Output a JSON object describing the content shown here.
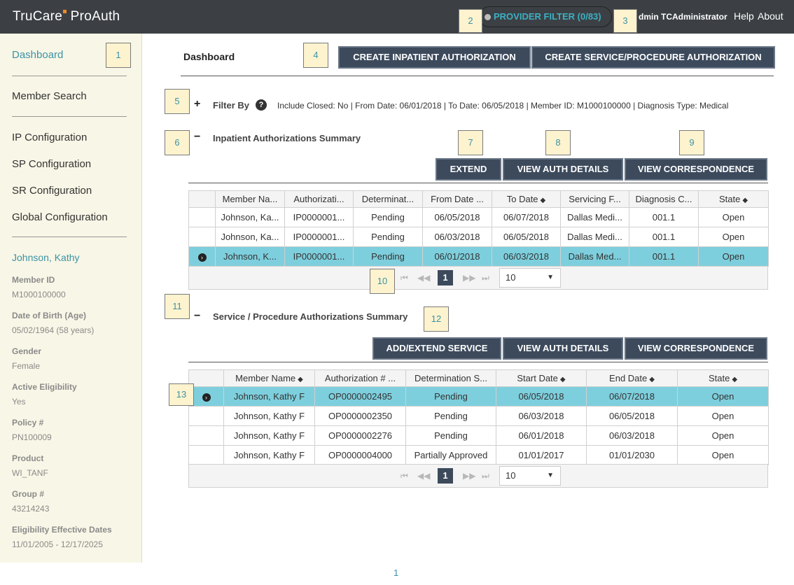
{
  "app": {
    "logo_part1": "TruCare",
    "logo_part2": "ProAuth"
  },
  "header": {
    "provider_filter": "PROVIDER FILTER (0/83)",
    "user": "dmin TCAdministrator",
    "help": "Help",
    "about": "About"
  },
  "callouts": [
    "1",
    "2",
    "3",
    "4",
    "5",
    "6",
    "7",
    "8",
    "9",
    "10",
    "11",
    "12",
    "13"
  ],
  "sidebar": {
    "nav": [
      "Dashboard",
      "Member Search",
      "IP Configuration",
      "SP Configuration",
      "SR Configuration",
      "Global Configuration"
    ],
    "member_name": "Johnson, Kathy",
    "fields": [
      {
        "label": "Member ID",
        "value": "M1000100000"
      },
      {
        "label": "Date of Birth (Age)",
        "value": "05/02/1964 (58 years)"
      },
      {
        "label": "Gender",
        "value": "Female"
      },
      {
        "label": "Active Eligibility",
        "value": "Yes"
      },
      {
        "label": "Policy #",
        "value": "PN100009"
      },
      {
        "label": "Product",
        "value": "WI_TANF"
      },
      {
        "label": "Group #",
        "value": "43214243"
      },
      {
        "label": "Eligibility Effective Dates",
        "value": "11/01/2005 - 12/17/2025"
      }
    ]
  },
  "main": {
    "title": "Dashboard",
    "create_inpatient": "CREATE INPATIENT AUTHORIZATION",
    "create_service": "CREATE SERVICE/PROCEDURE AUTHORIZATION",
    "filter": {
      "toggle": "+",
      "label": "Filter By",
      "help": "?",
      "text": "Include Closed: No | From Date: 06/01/2018 | To Date: 06/05/2018 | Member ID: M1000100000 | Diagnosis Type: Medical"
    },
    "inpatient": {
      "toggle": "−",
      "title": "Inpatient Authorizations Summary",
      "buttons": {
        "extend": "EXTEND",
        "view_details": "VIEW AUTH DETAILS",
        "view_corr": "VIEW CORRESPONDENCE"
      },
      "columns": [
        "",
        "Member Na...",
        "Authorizati...",
        "Determinat...",
        "From Date ...",
        "To Date",
        "Servicing F...",
        "Diagnosis C...",
        "State"
      ],
      "sort_icon": "◆",
      "row_icon": "›",
      "rows": [
        {
          "selected": false,
          "cells": [
            "Johnson, Ka...",
            "IP0000001...",
            "Pending",
            "06/05/2018",
            "06/07/2018",
            "Dallas Medi...",
            "001.1",
            "Open"
          ]
        },
        {
          "selected": false,
          "cells": [
            "Johnson, Ka...",
            "IP0000001...",
            "Pending",
            "06/03/2018",
            "06/05/2018",
            "Dallas Medi...",
            "001.1",
            "Open"
          ]
        },
        {
          "selected": true,
          "cells": [
            "Johnson, K...",
            "IP0000001...",
            "Pending",
            "06/01/2018",
            "06/03/2018",
            "Dallas Med...",
            "001.1",
            "Open"
          ]
        }
      ],
      "pager": {
        "page": "1",
        "size": "10",
        "first": "⏮",
        "prev": "◀◀",
        "next": "▶▶",
        "last": "⏭",
        "caret": "▼"
      }
    },
    "service": {
      "toggle": "−",
      "title": "Service / Procedure Authorizations Summary",
      "buttons": {
        "add_extend": "ADD/EXTEND SERVICE",
        "view_details": "VIEW AUTH DETAILS",
        "view_corr": "VIEW CORRESPONDENCE"
      },
      "columns": [
        "",
        "Member Name",
        "Authorization # ...",
        "Determination S...",
        "Start Date",
        "End Date",
        "State"
      ],
      "rows": [
        {
          "selected": true,
          "cells": [
            "Johnson, Kathy F",
            "OP0000002495",
            "Pending",
            "06/05/2018",
            "06/07/2018",
            "Open"
          ]
        },
        {
          "selected": false,
          "cells": [
            "Johnson, Kathy F",
            "OP0000002350",
            "Pending",
            "06/03/2018",
            "06/05/2018",
            "Open"
          ]
        },
        {
          "selected": false,
          "cells": [
            "Johnson, Kathy F",
            "OP0000002276",
            "Pending",
            "06/01/2018",
            "06/03/2018",
            "Open"
          ]
        },
        {
          "selected": false,
          "cells": [
            "Johnson, Kathy F",
            "OP0000004000",
            "Partially Approved",
            "01/01/2017",
            "01/01/2030",
            "Open"
          ]
        }
      ],
      "pager": {
        "page": "1",
        "size": "10"
      }
    }
  },
  "footer": {
    "page_number": "1"
  },
  "colors": {
    "topbar": "#3c4044",
    "accent": "#3bb1c4",
    "button": "#3c4a5c",
    "selected_row": "#7ecfdd",
    "sidebar": "#f8f6e6"
  }
}
